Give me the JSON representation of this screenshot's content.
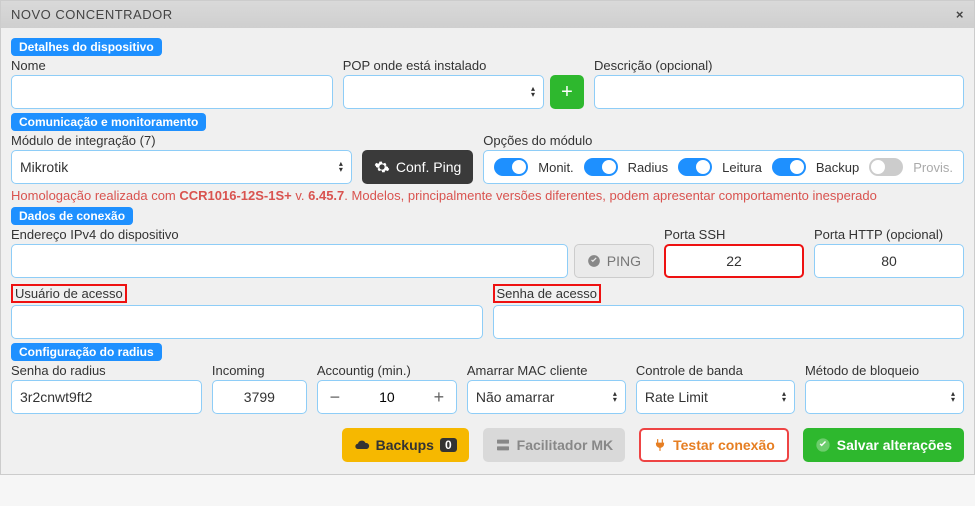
{
  "header": {
    "title": "NOVO CONCENTRADOR"
  },
  "device": {
    "legend": "Detalhes do dispositivo",
    "name_label": "Nome",
    "pop_label": "POP onde está instalado",
    "desc_label": "Descrição (opcional)"
  },
  "comm": {
    "legend": "Comunicação e monitoramento",
    "module_label": "Módulo de integração (7)",
    "module_value": "Mikrotik",
    "conf_ping": "Conf. Ping",
    "options_label": "Opções do módulo",
    "toggles": {
      "monit": "Monit.",
      "radius": "Radius",
      "leitura": "Leitura",
      "backup": "Backup",
      "provis": "Provis."
    },
    "warning_pre": "Homologação realizada com ",
    "warning_model": "CCR1016-12S-1S+",
    "warning_mid": " v. ",
    "warning_ver": "6.45.7",
    "warning_post": ". Modelos, principalmente versões diferentes, podem apresentar comportamento inesperado"
  },
  "conn": {
    "legend": "Dados de conexão",
    "ipv4_label": "Endereço IPv4 do dispositivo",
    "ping_btn": "PING",
    "ssh_label": "Porta SSH",
    "ssh_value": "22",
    "http_label": "Porta HTTP (opcional)",
    "http_value": "80",
    "user_label": "Usuário de acesso",
    "pass_label": "Senha de acesso"
  },
  "radius": {
    "legend": "Configuração do radius",
    "secret_label": "Senha do radius",
    "secret_value": "3r2cnwt9ft2",
    "incoming_label": "Incoming",
    "incoming_value": "3799",
    "acct_label": "Accountig (min.)",
    "acct_value": "10",
    "mac_label": "Amarrar MAC cliente",
    "mac_value": "Não amarrar",
    "band_label": "Controle de banda",
    "band_value": "Rate Limit",
    "block_label": "Método de bloqueio"
  },
  "footer": {
    "backups": "Backups",
    "backups_count": "0",
    "facilitador": "Facilitador MK",
    "test": "Testar conexão",
    "save": "Salvar alterações"
  }
}
